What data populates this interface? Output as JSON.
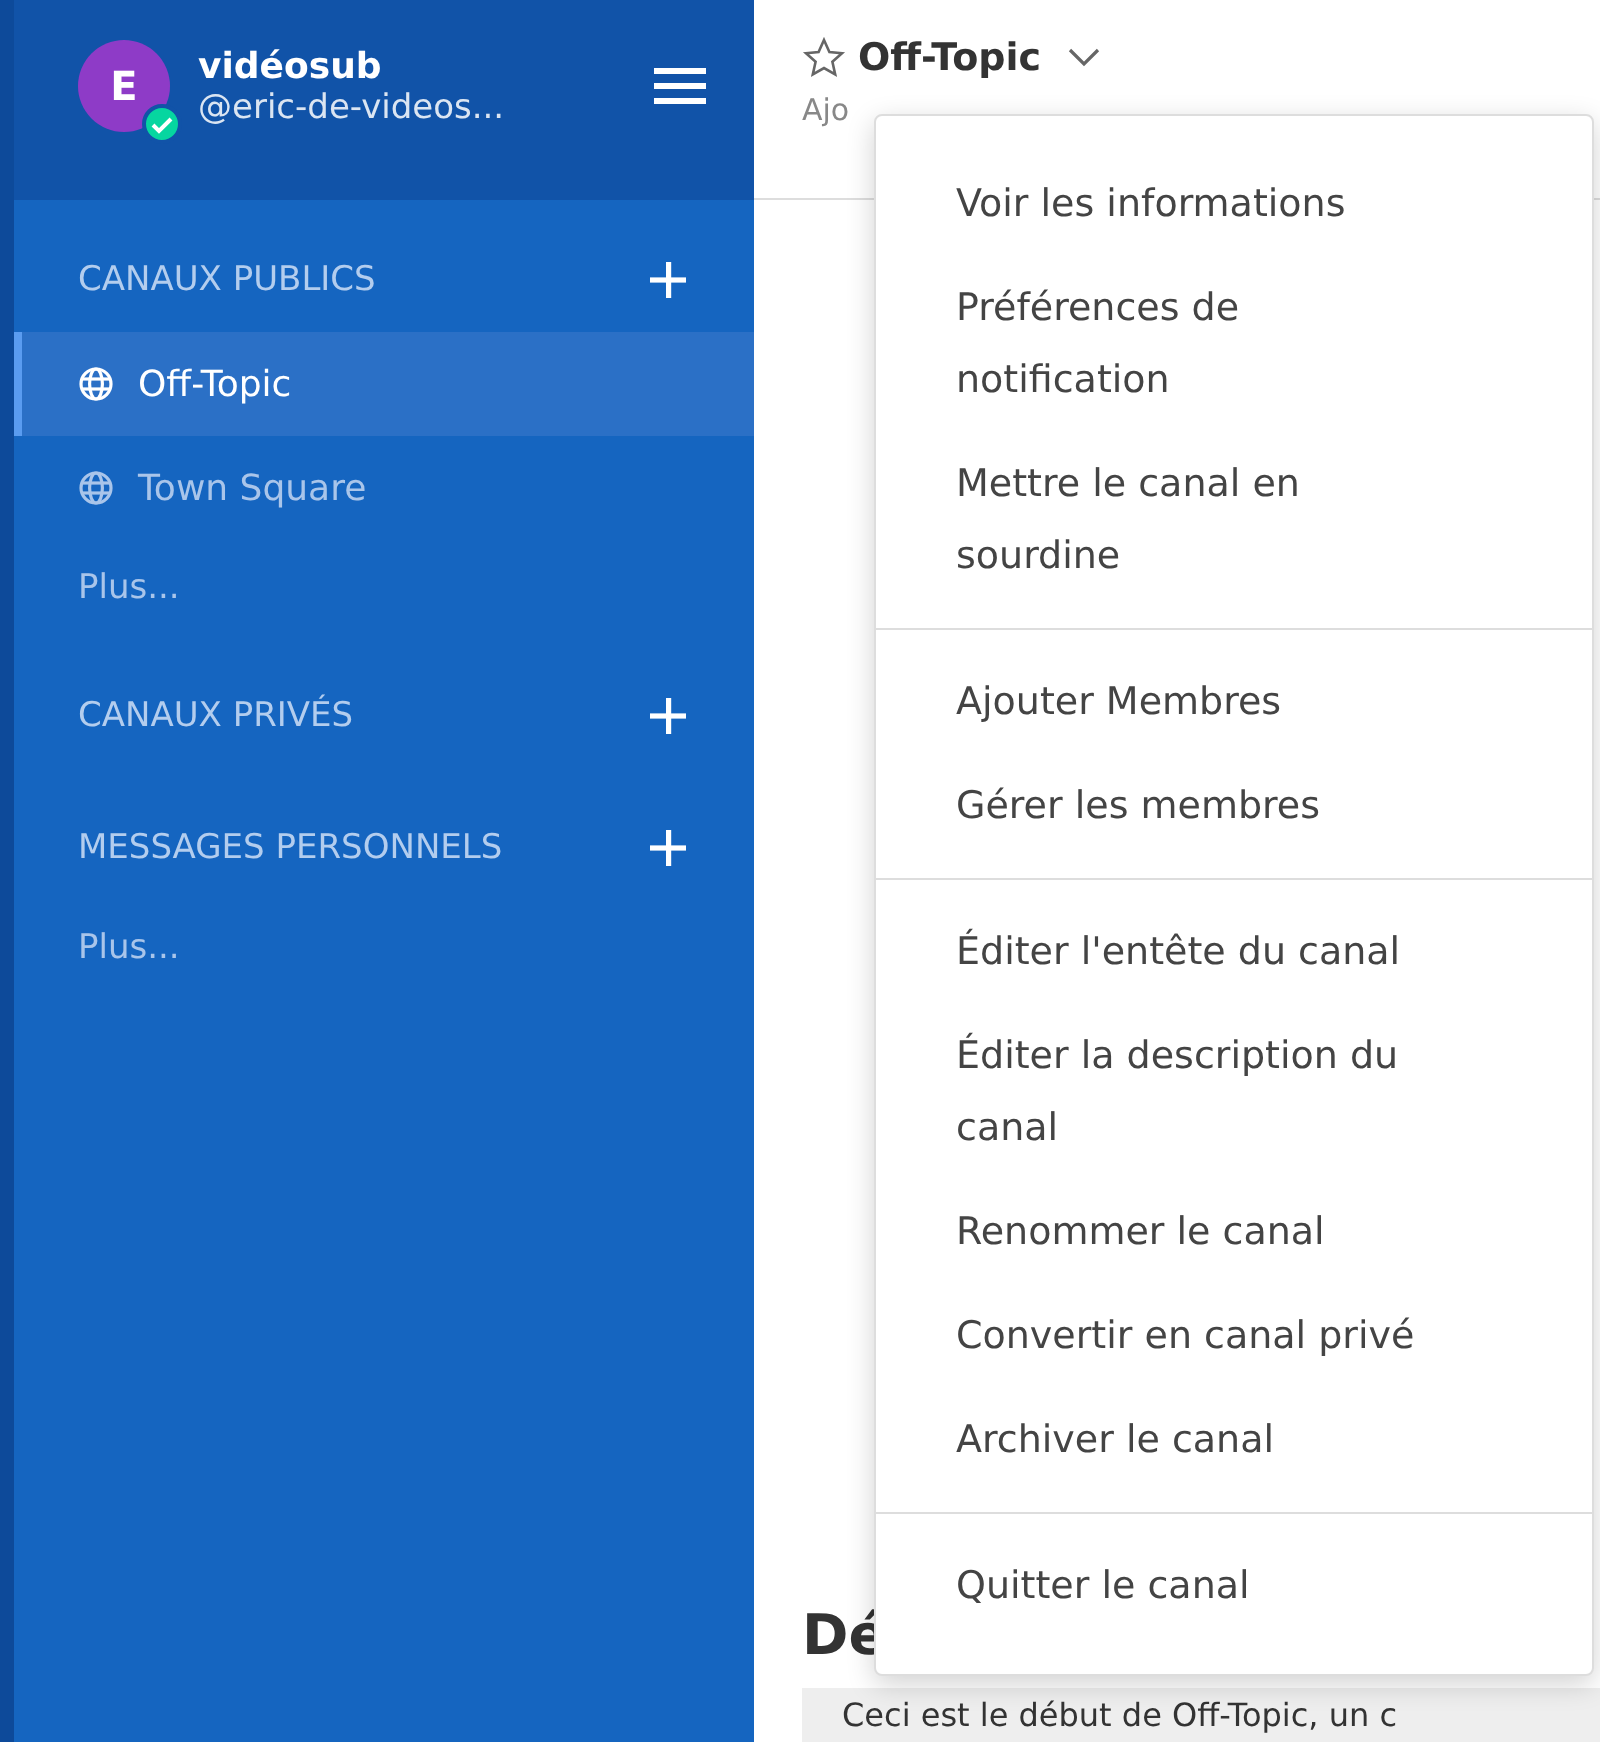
{
  "sidebar": {
    "team": {
      "avatar_letter": "E",
      "name": "vidéosub",
      "handle": "@eric-de-videos...",
      "online": true
    },
    "sections": [
      {
        "title": "CANAUX PUBLICS",
        "items": [
          {
            "label": "Off-Topic",
            "kind": "channel",
            "selected": true
          },
          {
            "label": "Town Square",
            "kind": "channel",
            "selected": false
          },
          {
            "label": "Plus...",
            "kind": "more",
            "selected": false
          }
        ]
      },
      {
        "title": "CANAUX PRIVÉS"
      },
      {
        "title": "MESSAGES PERSONNELS",
        "items": [
          {
            "label": "Plus...",
            "kind": "more",
            "selected": false
          }
        ]
      }
    ]
  },
  "channel_header": {
    "title": "Off-Topic",
    "favorite": false,
    "subtitle": "Ajo"
  },
  "content": {
    "heading": "Dé",
    "intro": "Ceci est le début de Off-Topic, un c"
  },
  "menu": {
    "groups": [
      [
        "Voir les informations",
        "Préférences de notification",
        "Mettre le canal en sourdine"
      ],
      [
        "Ajouter Membres",
        "Gérer les membres"
      ],
      [
        "Éditer l'entête du canal",
        "Éditer la description du canal",
        "Renommer le canal",
        "Convertir en canal privé",
        "Archiver le canal"
      ],
      [
        "Quitter le canal"
      ]
    ]
  }
}
